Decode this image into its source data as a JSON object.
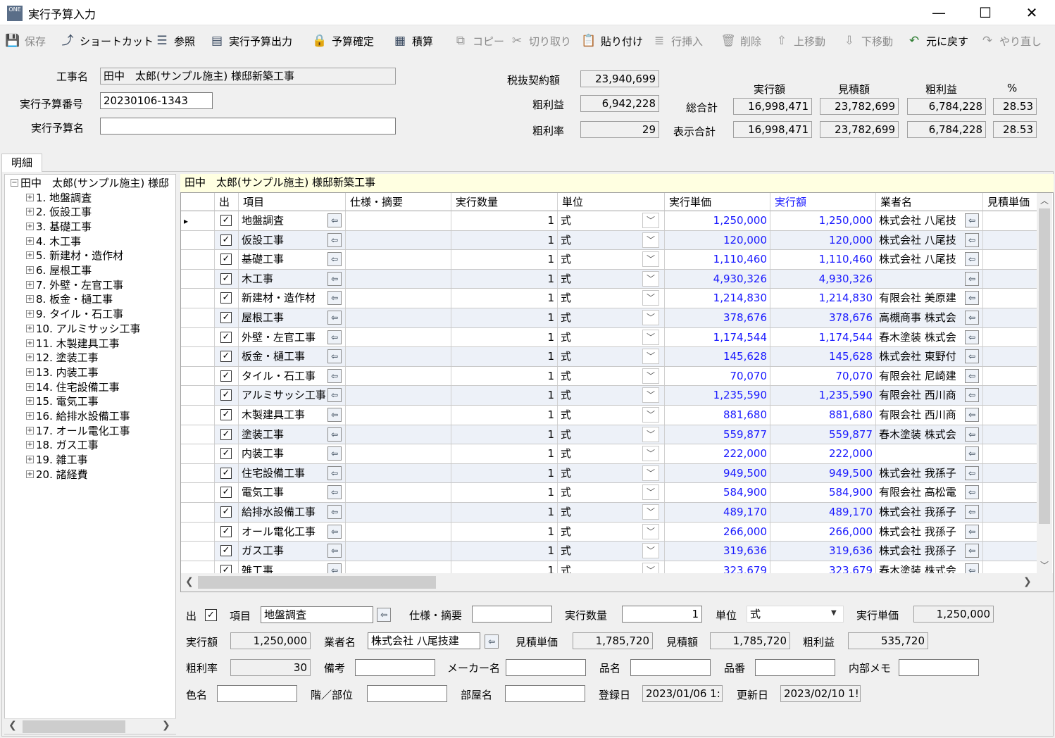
{
  "window": {
    "title": "実行予算入力",
    "app_icon": "ONE",
    "minimize": "—",
    "maximize": "☐",
    "close": "✕"
  },
  "toolbar": [
    {
      "label": "保存",
      "icon": "save-icon",
      "enabled": false
    },
    {
      "label": "ショートカット",
      "icon": "shortcut-icon",
      "enabled": true
    },
    {
      "label": "参照",
      "icon": "reference-icon",
      "enabled": true
    },
    {
      "label": "実行予算出力",
      "icon": "output-icon",
      "enabled": true
    },
    {
      "label": "予算確定",
      "icon": "lock-icon",
      "enabled": true
    },
    {
      "label": "積算",
      "icon": "calc-icon",
      "enabled": true
    },
    {
      "label": "コピー",
      "icon": "copy-icon",
      "enabled": false
    },
    {
      "label": "切り取り",
      "icon": "cut-icon",
      "enabled": false
    },
    {
      "label": "貼り付け",
      "icon": "paste-icon",
      "enabled": true
    },
    {
      "label": "行挿入",
      "icon": "insert-row-icon",
      "enabled": false
    },
    {
      "label": "削除",
      "icon": "trash-icon",
      "enabled": false
    },
    {
      "label": "上移動",
      "icon": "move-up-icon",
      "enabled": false
    },
    {
      "label": "下移動",
      "icon": "move-down-icon",
      "enabled": false
    },
    {
      "label": "元に戻す",
      "icon": "undo-icon",
      "enabled": true
    },
    {
      "label": "やり直し",
      "icon": "redo-icon",
      "enabled": false
    }
  ],
  "header": {
    "project_name_label": "工事名",
    "project_name": "田中　太郎(サンプル施主) 様邸新築工事",
    "budget_no_label": "実行予算番号",
    "budget_no": "20230106-1343",
    "budget_name_label": "実行予算名",
    "budget_name": "",
    "contract_label": "税抜契約額",
    "contract": "23,940,699",
    "profit_label": "粗利益",
    "profit": "6,942,228",
    "rate_label": "粗利率",
    "rate": "29",
    "col_exec": "実行額",
    "col_est": "見積額",
    "col_profit": "粗利益",
    "col_pct": "%",
    "total_label": "総合計",
    "total_exec": "16,998,471",
    "total_est": "23,782,699",
    "total_profit": "6,784,228",
    "total_pct": "28.53",
    "disp_label": "表示合計",
    "disp_exec": "16,998,471",
    "disp_est": "23,782,699",
    "disp_profit": "6,784,228",
    "disp_pct": "28.53"
  },
  "tab": {
    "label": "明細"
  },
  "tree": {
    "root": "田中　太郎(サンプル施主) 様邸",
    "items": [
      "1. 地盤調査",
      "2. 仮設工事",
      "3. 基礎工事",
      "4. 木工事",
      "5. 新建材・造作材",
      "6. 屋根工事",
      "7. 外壁・左官工事",
      "8. 板金・樋工事",
      "9. タイル・石工事",
      "10. アルミサッシ工事",
      "11. 木製建具工事",
      "12. 塗装工事",
      "13. 内装工事",
      "14. 住宅設備工事",
      "15. 電気工事",
      "16. 給排水設備工事",
      "17. オール電化工事",
      "18. ガス工事",
      "19. 雑工事",
      "20. 諸経費"
    ]
  },
  "grid": {
    "title": "田中　太郎(サンプル施主) 様邸新築工事",
    "headers": {
      "out": "出",
      "item": "項目",
      "spec": "仕様・摘要",
      "qty": "実行数量",
      "unit": "単位",
      "price": "実行単価",
      "amount": "実行額",
      "vendor": "業者名",
      "est_price": "見積単価"
    },
    "rows": [
      {
        "item": "地盤調査",
        "qty": "1",
        "unit": "式",
        "price": "1,250,000",
        "amount": "1,250,000",
        "vendor": "株式会社 八尾技"
      },
      {
        "item": "仮設工事",
        "qty": "1",
        "unit": "式",
        "price": "120,000",
        "amount": "120,000",
        "vendor": "株式会社 八尾技"
      },
      {
        "item": "基礎工事",
        "qty": "1",
        "unit": "式",
        "price": "1,110,460",
        "amount": "1,110,460",
        "vendor": "株式会社 八尾技"
      },
      {
        "item": "木工事",
        "qty": "1",
        "unit": "式",
        "price": "4,930,326",
        "amount": "4,930,326",
        "vendor": ""
      },
      {
        "item": "新建材・造作材",
        "qty": "1",
        "unit": "式",
        "price": "1,214,830",
        "amount": "1,214,830",
        "vendor": "有限会社 美原建"
      },
      {
        "item": "屋根工事",
        "qty": "1",
        "unit": "式",
        "price": "378,676",
        "amount": "378,676",
        "vendor": "高槻商事 株式会"
      },
      {
        "item": "外壁・左官工事",
        "qty": "1",
        "unit": "式",
        "price": "1,174,544",
        "amount": "1,174,544",
        "vendor": "春木塗装 株式会"
      },
      {
        "item": "板金・樋工事",
        "qty": "1",
        "unit": "式",
        "price": "145,628",
        "amount": "145,628",
        "vendor": "株式会社 東野付"
      },
      {
        "item": "タイル・石工事",
        "qty": "1",
        "unit": "式",
        "price": "70,070",
        "amount": "70,070",
        "vendor": "有限会社 尼崎建"
      },
      {
        "item": "アルミサッシ工事",
        "qty": "1",
        "unit": "式",
        "price": "1,235,590",
        "amount": "1,235,590",
        "vendor": "有限会社 西川商"
      },
      {
        "item": "木製建具工事",
        "qty": "1",
        "unit": "式",
        "price": "881,680",
        "amount": "881,680",
        "vendor": "有限会社 西川商"
      },
      {
        "item": "塗装工事",
        "qty": "1",
        "unit": "式",
        "price": "559,877",
        "amount": "559,877",
        "vendor": "春木塗装 株式会"
      },
      {
        "item": "内装工事",
        "qty": "1",
        "unit": "式",
        "price": "222,000",
        "amount": "222,000",
        "vendor": ""
      },
      {
        "item": "住宅設備工事",
        "qty": "1",
        "unit": "式",
        "price": "949,500",
        "amount": "949,500",
        "vendor": "株式会社 我孫子"
      },
      {
        "item": "電気工事",
        "qty": "1",
        "unit": "式",
        "price": "584,900",
        "amount": "584,900",
        "vendor": "有限会社 高松電"
      },
      {
        "item": "給排水設備工事",
        "qty": "1",
        "unit": "式",
        "price": "489,170",
        "amount": "489,170",
        "vendor": "株式会社 我孫子"
      },
      {
        "item": "オール電化工事",
        "qty": "1",
        "unit": "式",
        "price": "266,000",
        "amount": "266,000",
        "vendor": "株式会社 我孫子"
      },
      {
        "item": "ガス工事",
        "qty": "1",
        "unit": "式",
        "price": "319,636",
        "amount": "319,636",
        "vendor": "株式会社 我孫子"
      },
      {
        "item": "雑工事",
        "qty": "1",
        "unit": "式",
        "price": "323,679",
        "amount": "323,679",
        "vendor": "春木塗装 株式会"
      }
    ]
  },
  "detail": {
    "out_label": "出",
    "item_label": "項目",
    "item": "地盤調査",
    "spec_label": "仕様・摘要",
    "spec": "",
    "qty_label": "実行数量",
    "qty": "1",
    "unit_label": "単位",
    "unit": "式",
    "price_label": "実行単価",
    "price": "1,250,000",
    "amount_label": "実行額",
    "amount": "1,250,000",
    "vendor_label": "業者名",
    "vendor": "株式会社 八尾技建",
    "est_price_label": "見積単価",
    "est_price": "1,785,720",
    "est_amount_label": "見積額",
    "est_amount": "1,785,720",
    "profit_label": "粗利益",
    "profit": "535,720",
    "rate_label": "粗利率",
    "rate": "30",
    "note_label": "備考",
    "note": "",
    "maker_label": "メーカー名",
    "maker": "",
    "product_label": "品名",
    "product": "",
    "part_no_label": "品番",
    "part_no": "",
    "memo_label": "内部メモ",
    "memo": "",
    "color_label": "色名",
    "color": "",
    "floor_label": "階／部位",
    "floor": "",
    "room_label": "部屋名",
    "room": "",
    "reg_label": "登録日",
    "reg_date": "2023/01/06 1:",
    "upd_label": "更新日",
    "upd_date": "2023/02/10 1!"
  }
}
